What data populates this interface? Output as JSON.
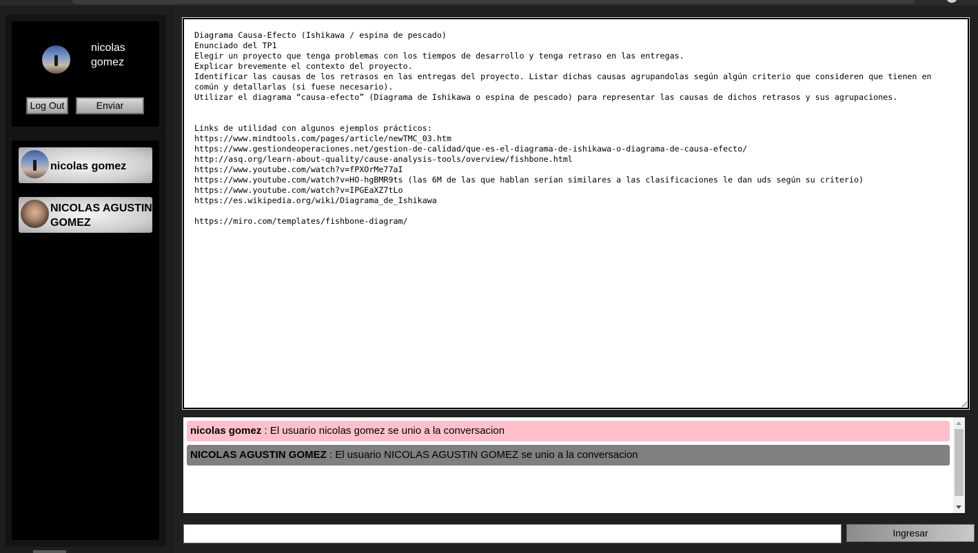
{
  "profile": {
    "name": "nicolas gomez",
    "logout_label": "Log Out",
    "send_label": "Enviar"
  },
  "contacts": [
    {
      "name": "nicolas gomez"
    },
    {
      "name": "NICOLAS AGUSTIN GOMEZ"
    }
  ],
  "document": {
    "text": "Diagrama Causa-Efecto (Ishikawa / espina de pescado)\nEnunciado del TP1\nElegir un proyecto que tenga problemas con los tiempos de desarrollo y tenga retraso en las entregas.\nExplicar brevemente el contexto del proyecto.\nIdentificar las causas de los retrasos en las entregas del proyecto. Listar dichas causas agrupandolas según algún criterio que consideren que tienen en común y detallarlas (si fuese necesario).\nUtilizar el diagrama “causa-efecto” (Diagrama de Ishikawa o espina de pescado) para representar las causas de dichos retrasos y sus agrupaciones.\n\n\nLinks de utilidad con algunos ejemplos prácticos:\nhttps://www.mindtools.com/pages/article/newTMC_03.htm\nhttps://www.gestiondeoperaciones.net/gestion-de-calidad/que-es-el-diagrama-de-ishikawa-o-diagrama-de-causa-efecto/\nhttp://asq.org/learn-about-quality/cause-analysis-tools/overview/fishbone.html\nhttps://www.youtube.com/watch?v=fPXOrMe77aI\nhttps://www.youtube.com/watch?v=HO-hgBMR9ts (las 6M de las que hablan serían similares a las clasificaciones le dan uds según su criterio)\nhttps://www.youtube.com/watch?v=IPGEaXZ7tLo\nhttps://es.wikipedia.org/wiki/Diagrama_de_Ishikawa\n\nhttps://miro.com/templates/fishbone-diagram/"
  },
  "chat": {
    "messages": [
      {
        "user": "nicolas gomez",
        "separator": " : ",
        "text": "El usuario nicolas gomez se unio a la conversacion",
        "color": "#ffc0cb"
      },
      {
        "user": "NICOLAS AGUSTIN GOMEZ",
        "separator": " : ",
        "text": "El usuario NICOLAS AGUSTIN GOMEZ se unio a la conversacion",
        "color": "#808080"
      }
    ]
  },
  "input": {
    "value": "",
    "placeholder": "",
    "submit_label": "Ingresar"
  },
  "icons": {
    "user_avatar": "avatar-icon",
    "scroll_up": "scroll-up-arrow-icon",
    "scroll_down": "scroll-down-arrow-icon"
  }
}
